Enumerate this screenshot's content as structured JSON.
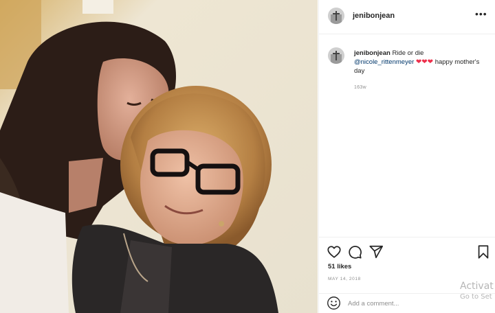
{
  "post": {
    "username": "jenibonjean",
    "photo_icon": "photo-two-women-selfie",
    "more_icon": "more-horizontal-icon"
  },
  "caption": {
    "username": "jenibonjean",
    "text_start": "Ride or die",
    "mention": "@nicole_rittenmeyer",
    "hearts": "❤❤❤",
    "text_end": "happy mother's day",
    "time_ago": "163w"
  },
  "actions": {
    "like_icon": "heart-icon",
    "comment_icon": "comment-icon",
    "share_icon": "share-icon",
    "save_icon": "bookmark-icon",
    "likes": "51 likes",
    "date": "MAY 14, 2018"
  },
  "comment_box": {
    "emoji_icon": "emoji-icon",
    "placeholder": "Add a comment..."
  },
  "watermark": {
    "line1": "Activat",
    "line2": "Go to Set"
  },
  "colors": {
    "mention": "#00376b",
    "heart": "#ed2f4b",
    "muted": "#8e8e8e"
  }
}
